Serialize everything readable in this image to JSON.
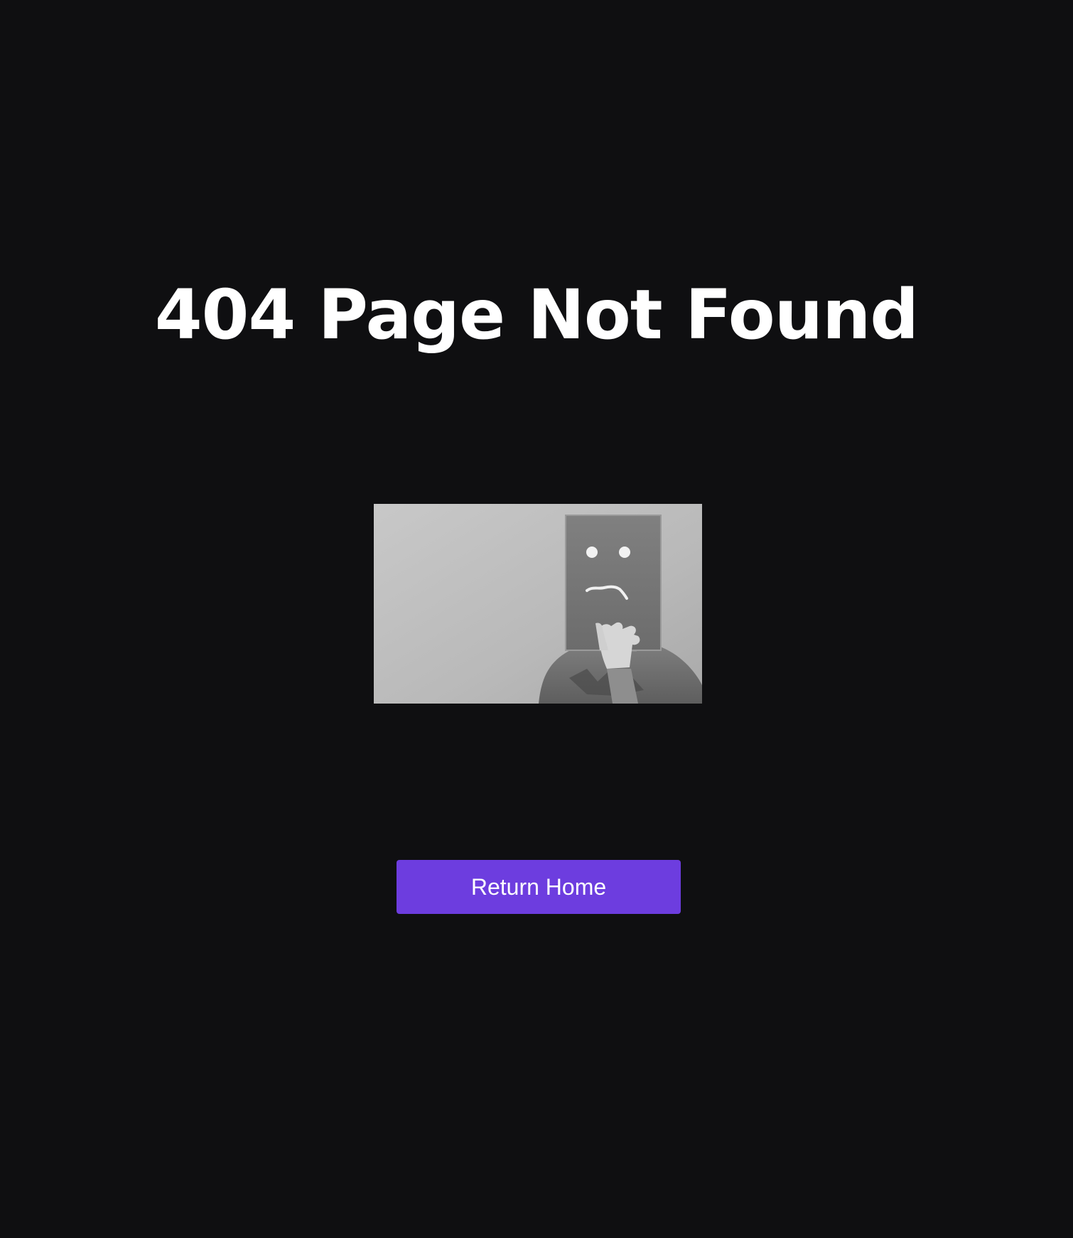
{
  "heading": {
    "text": "404 Page Not Found"
  },
  "illustration": {
    "icon": "sad-face-mask-photo",
    "tone": "grayscale"
  },
  "action": {
    "label": "Return Home"
  },
  "colors": {
    "background": "#0f0f11",
    "heading": "#ffffff",
    "button": "#6d3ddf",
    "button_text": "#ffffff"
  }
}
